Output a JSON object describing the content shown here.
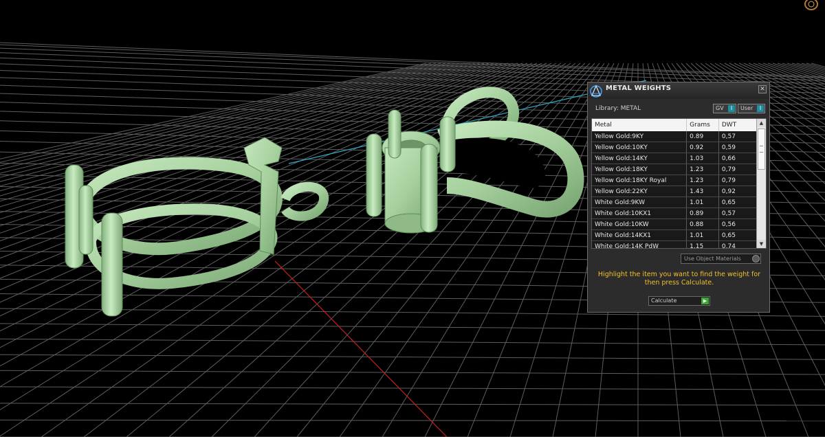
{
  "viewport": {
    "background": "#000000",
    "grid_color": "#5e5e5e",
    "axis_x_color": "#c81e1e",
    "axis_y_color": "#2fa9c8",
    "model_color": "#a9d4a2"
  },
  "panel": {
    "title": "METAL WEIGHTS",
    "logo_icon": "product-logo-icon",
    "close_glyph": "✕",
    "library_label": "Library: METAL",
    "source_buttons": [
      {
        "label": "GV",
        "indicator": "I"
      },
      {
        "label": "User",
        "indicator": "I"
      }
    ],
    "table": {
      "headers": [
        "Metal",
        "Grams",
        "DWT"
      ],
      "rows": [
        [
          "Yellow Gold:9KY",
          "0.89",
          "0,57"
        ],
        [
          "Yellow Gold:10KY",
          "0.92",
          "0,59"
        ],
        [
          "Yellow Gold:14KY",
          "1.03",
          "0,66"
        ],
        [
          "Yellow Gold:18KY",
          "1.23",
          "0,79"
        ],
        [
          "Yellow Gold:18KY Royal",
          "1.23",
          "0,79"
        ],
        [
          "Yellow Gold:22KY",
          "1.43",
          "0,92"
        ],
        [
          "White Gold:9KW",
          "1.01",
          "0,65"
        ],
        [
          "White Gold:10KX1",
          "0.89",
          "0,57"
        ],
        [
          "White Gold:10KW",
          "0.88",
          "0,56"
        ],
        [
          "White Gold:14KX1",
          "1.01",
          "0,65"
        ],
        [
          "White Gold:14K PdW",
          "1.15",
          "0,74"
        ]
      ]
    },
    "use_object_materials": "Use Object Materials",
    "instructions": "Highlight the item you want to find the weight for then press Calculate.",
    "calculate_label": "Calculate",
    "accent_color": "#f2c12e",
    "indicator_color": "#1e8fa0",
    "go_color": "#3aa832"
  }
}
